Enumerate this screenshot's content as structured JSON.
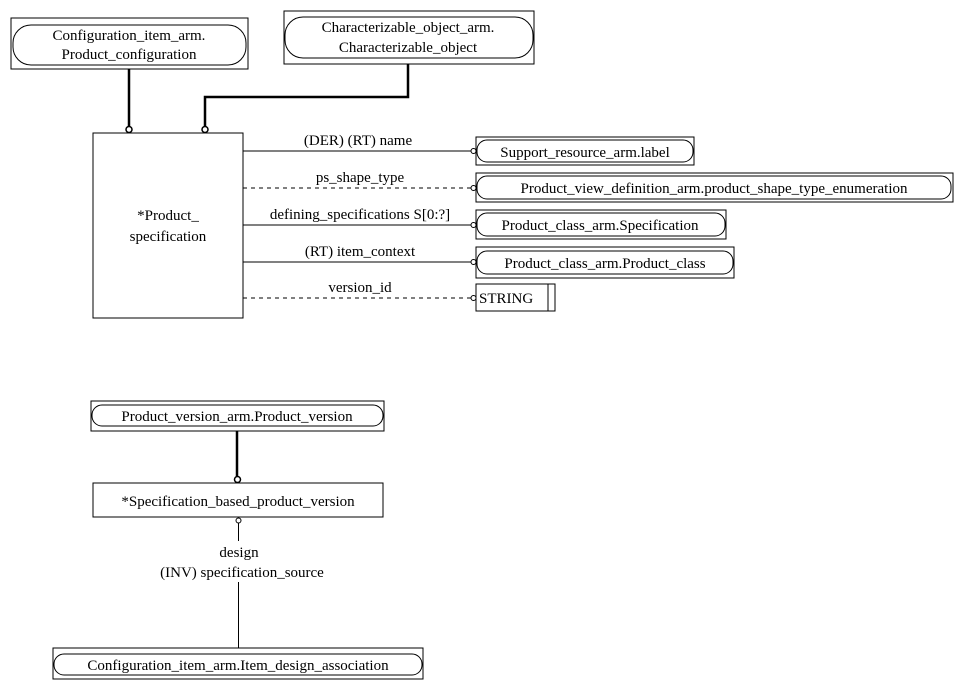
{
  "diagram": {
    "entities": {
      "config_product_configuration": {
        "line1": "Configuration_item_arm.",
        "line2": "Product_configuration"
      },
      "characterizable_object": {
        "line1": "Characterizable_object_arm.",
        "line2": "Characterizable_object"
      },
      "product_specification": {
        "line1": "*Product_",
        "line2": "specification"
      },
      "support_resource_label": {
        "label": "Support_resource_arm.label"
      },
      "product_shape_type_enum": {
        "label": "Product_view_definition_arm.product_shape_type_enumeration"
      },
      "product_class_specification": {
        "label": "Product_class_arm.Specification"
      },
      "product_class_product_class": {
        "label": "Product_class_arm.Product_class"
      },
      "string_type": {
        "label": "STRING"
      },
      "product_version": {
        "label": "Product_version_arm.Product_version"
      },
      "specification_based_product_version": {
        "label": "*Specification_based_product_version"
      },
      "item_design_association": {
        "label": "Configuration_item_arm.Item_design_association"
      }
    },
    "relations": {
      "name": "(DER) (RT) name",
      "ps_shape_type": "ps_shape_type",
      "defining_specifications": "defining_specifications S[0:?]",
      "item_context": "(RT) item_context",
      "version_id": "version_id",
      "design_line1": "design",
      "design_line2": "(INV) specification_source"
    }
  }
}
